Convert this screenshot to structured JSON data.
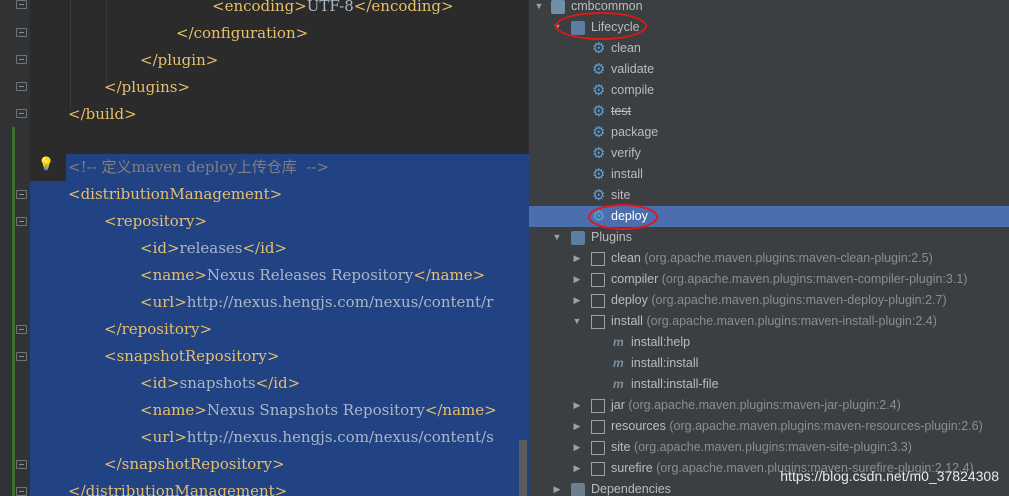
{
  "editor": {
    "lines": [
      {
        "tag_open": "<encoding>",
        "text": "UTF-8",
        "tag_close": "</encoding>"
      },
      {
        "tag": "</configuration>"
      },
      {
        "tag": "</plugin>"
      },
      {
        "tag": "</plugins>"
      },
      {
        "tag": "</build>"
      },
      {
        "comment": "<!-- 定义maven deploy上传仓库  -->"
      },
      {
        "tag": "<distributionManagement>"
      },
      {
        "tag": "<repository>"
      },
      {
        "tag_open": "<id>",
        "text": "releases",
        "tag_close": "</id>"
      },
      {
        "tag_open": "<name>",
        "text": "Nexus Releases Repository",
        "tag_close": "</name>"
      },
      {
        "tag_open": "<url>",
        "text": "http://nexus.hengjs.com/nexus/content/r",
        "tag_close": ""
      },
      {
        "tag": "</repository>"
      },
      {
        "tag": "<snapshotRepository>"
      },
      {
        "tag_open": "<id>",
        "text": "snapshots",
        "tag_close": "</id>"
      },
      {
        "tag_open": "<name>",
        "text": "Nexus Snapshots Repository",
        "tag_close": "</name>"
      },
      {
        "tag_open": "<url>",
        "text": "http://nexus.hengjs.com/nexus/content/s",
        "tag_close": ""
      },
      {
        "tag": "</snapshotRepository>"
      },
      {
        "tag": "</distributionManagement>"
      }
    ]
  },
  "maven": {
    "project": "cmbcommon",
    "lifecycle_label": "Lifecycle",
    "lifecycle": [
      "clean",
      "validate",
      "compile",
      "test",
      "package",
      "verify",
      "install",
      "site",
      "deploy"
    ],
    "plugins_label": "Plugins",
    "plugins": [
      {
        "name": "clean",
        "coord": "(org.apache.maven.plugins:maven-clean-plugin:2.5)"
      },
      {
        "name": "compiler",
        "coord": "(org.apache.maven.plugins:maven-compiler-plugin:3.1)"
      },
      {
        "name": "deploy",
        "coord": "(org.apache.maven.plugins:maven-deploy-plugin:2.7)"
      },
      {
        "name": "install",
        "coord": "(org.apache.maven.plugins:maven-install-plugin:2.4)"
      },
      {
        "name": "jar",
        "coord": "(org.apache.maven.plugins:maven-jar-plugin:2.4)"
      },
      {
        "name": "resources",
        "coord": "(org.apache.maven.plugins:maven-resources-plugin:2.6)"
      },
      {
        "name": "site",
        "coord": "(org.apache.maven.plugins:maven-site-plugin:3.3)"
      },
      {
        "name": "surefire",
        "coord": "(org.apache.maven.plugins:maven-surefire-plugin:2.12.4)"
      }
    ],
    "install_goals": [
      "install:help",
      "install:install",
      "install:install-file"
    ],
    "dependencies_label": "Dependencies"
  },
  "watermark": "https://blog.csdn.net/m0_37824308",
  "colors": {
    "editor_bg": "#2b2b2b",
    "selection": "#214283",
    "tag": "#e8bf6a",
    "text": "#a9b7c6",
    "comment": "#808080",
    "panel_bg": "#3c3f41",
    "selected_row": "#4b6eaf",
    "highlight_ring": "#e01818"
  }
}
